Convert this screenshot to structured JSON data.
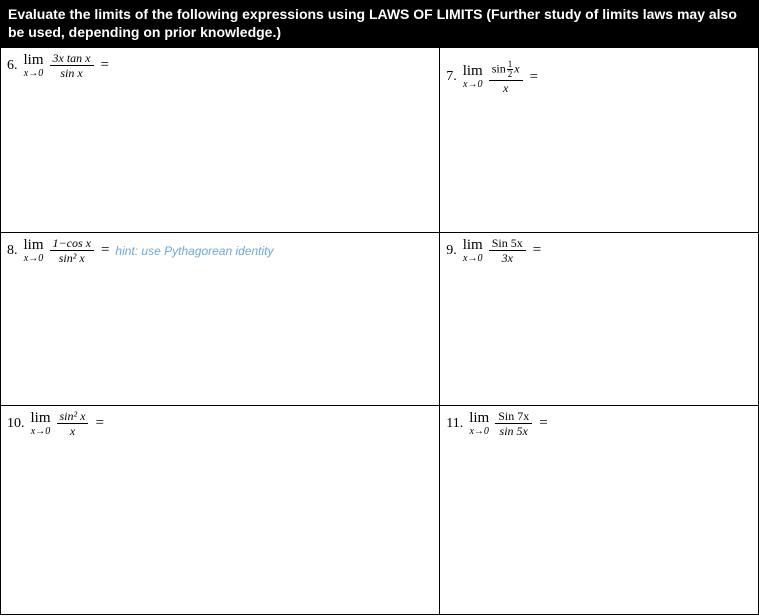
{
  "header": {
    "line1": "Evaluate the limits of the following expressions using LAWS OF LIMITS (Further study of limits laws may also",
    "line2": "be used, depending on prior knowledge.)"
  },
  "problems": {
    "p6": {
      "num": "6.",
      "limTop": "lim",
      "limBot": "x→0",
      "fracNu": "3x tan x",
      "fracDe": "sin x",
      "eq": "="
    },
    "p7": {
      "num": "7.",
      "limTop": "lim",
      "limBot": "x→0",
      "sinLabel": "sin",
      "halfNu": "1",
      "halfDe": "2",
      "xSuffix": "x",
      "fracDe": "x",
      "eq": "="
    },
    "p8": {
      "num": "8.",
      "limTop": "lim",
      "limBot": "x→0",
      "fracNu": "1−cos x",
      "fracDe": "sin² x",
      "eq": "=",
      "hint": "hint: use Pythagorean identity"
    },
    "p9": {
      "num": "9.",
      "limTop": "lim",
      "limBot": "x→0",
      "fracNu": "Sin 5x",
      "fracDe": "3x",
      "eq": "="
    },
    "p10": {
      "num": "10.",
      "limTop": "lim",
      "limBot": "x→0",
      "fracNu": "sin² x",
      "fracDe": "x",
      "eq": "="
    },
    "p11": {
      "num": "11.",
      "limTop": "lim",
      "limBot": "x→0",
      "fracNu": "Sin 7x",
      "fracDe": "sin 5x",
      "eq": "="
    }
  }
}
